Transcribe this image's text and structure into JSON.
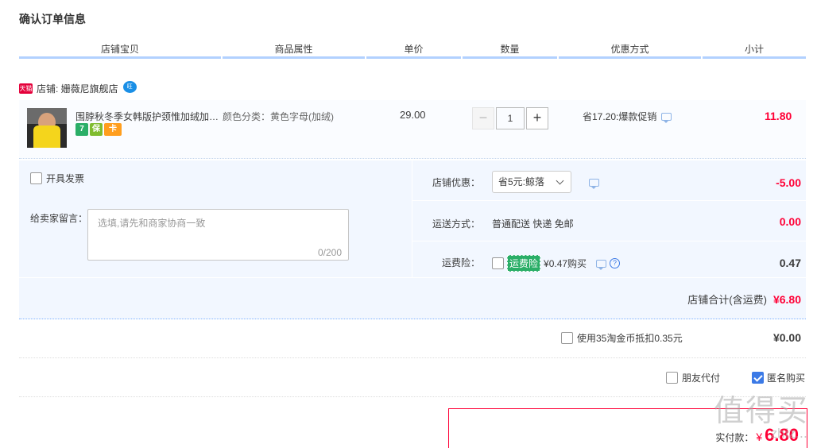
{
  "page_title": "确认订单信息",
  "columns": [
    "店铺宝贝",
    "商品属性",
    "单价",
    "数量",
    "优惠方式",
    "小计"
  ],
  "shop": {
    "badge": "天猫",
    "label": "店铺: 姗薇尼旗舰店",
    "ww_badge": "旺"
  },
  "item": {
    "title": "围脖秋冬季女韩版护颈惟加绒加…",
    "property": "颜色分类：黄色字母(加绒)",
    "price": "29.00",
    "quantity": "1",
    "minus": "−",
    "plus": "+",
    "promo": "省17.20:爆款促销",
    "subtotal": "11.80",
    "service_icons": [
      "7",
      "保",
      "卡"
    ]
  },
  "invoice": {
    "label": "开具发票"
  },
  "message": {
    "label": "给卖家留言：",
    "placeholder": "选填,请先和商家协商一致",
    "counter": "0/200"
  },
  "shop_discount": {
    "label": "店铺优惠：",
    "selected": "省5元:鲸落",
    "value": "-5.00"
  },
  "shipping": {
    "label": "运送方式：",
    "method": "普通配送 快递 免邮",
    "value": "0.00"
  },
  "insurance": {
    "label": "运费险：",
    "tag": "运费险",
    "text": "¥0.47购买",
    "value": "0.47",
    "help": "?"
  },
  "shop_total": {
    "label": "店铺合计(含运费)",
    "value": "¥6.80"
  },
  "coins": {
    "label": "使用35淘金币抵扣0.35元",
    "value": "¥0.00"
  },
  "options": {
    "friend_pay": "朋友代付",
    "anonymous": "匿名购买"
  },
  "final": {
    "label": "实付款：",
    "currency": "¥",
    "value": "6.80"
  },
  "watermark": {
    "main": "值得买",
    "sub": "zhiz..."
  }
}
